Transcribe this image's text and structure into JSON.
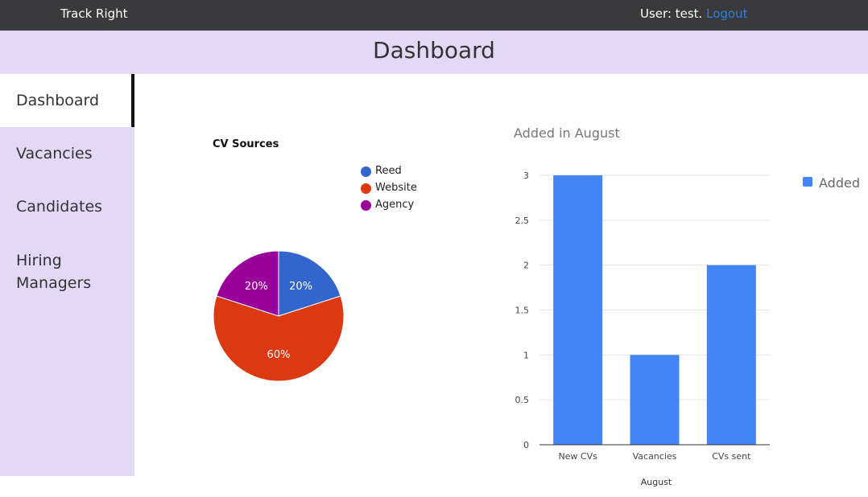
{
  "topbar": {
    "brand": "Track Right",
    "user_label": "User: test.",
    "logout_label": "Logout"
  },
  "header": {
    "title": "Dashboard"
  },
  "sidebar": {
    "items": [
      {
        "label": "Dashboard",
        "active": true
      },
      {
        "label": "Vacancies",
        "active": false
      },
      {
        "label": "Candidates",
        "active": false
      },
      {
        "label": "Hiring Managers",
        "active": false
      }
    ]
  },
  "colors": {
    "topbar": "#3a3a3c",
    "header": "#e3d9f7",
    "link": "#2f7fe0",
    "reed": "#3366cc",
    "website": "#dc3912",
    "agency": "#990099",
    "bar": "#4285f4"
  },
  "chart_data": [
    {
      "type": "pie",
      "title": "CV Sources",
      "legend_position": "right",
      "slices": [
        {
          "label": "Reed",
          "value": 20,
          "display": "20%",
          "color": "#3366cc"
        },
        {
          "label": "Website",
          "value": 60,
          "display": "60%",
          "color": "#dc3912"
        },
        {
          "label": "Agency",
          "value": 20,
          "display": "20%",
          "color": "#990099"
        }
      ]
    },
    {
      "type": "bar",
      "title": "Added in August",
      "xlabel": "August",
      "ylabel": "",
      "categories": [
        "New CVs",
        "Vacancies",
        "CVs sent"
      ],
      "series": [
        {
          "name": "Added",
          "values": [
            3,
            1,
            2
          ],
          "color": "#4285f4"
        }
      ],
      "ylim": [
        0,
        3
      ],
      "yticks": [
        "0",
        "0.5",
        "1",
        "1.5",
        "2",
        "2.5",
        "3"
      ],
      "grid": true,
      "legend_position": "right"
    }
  ]
}
